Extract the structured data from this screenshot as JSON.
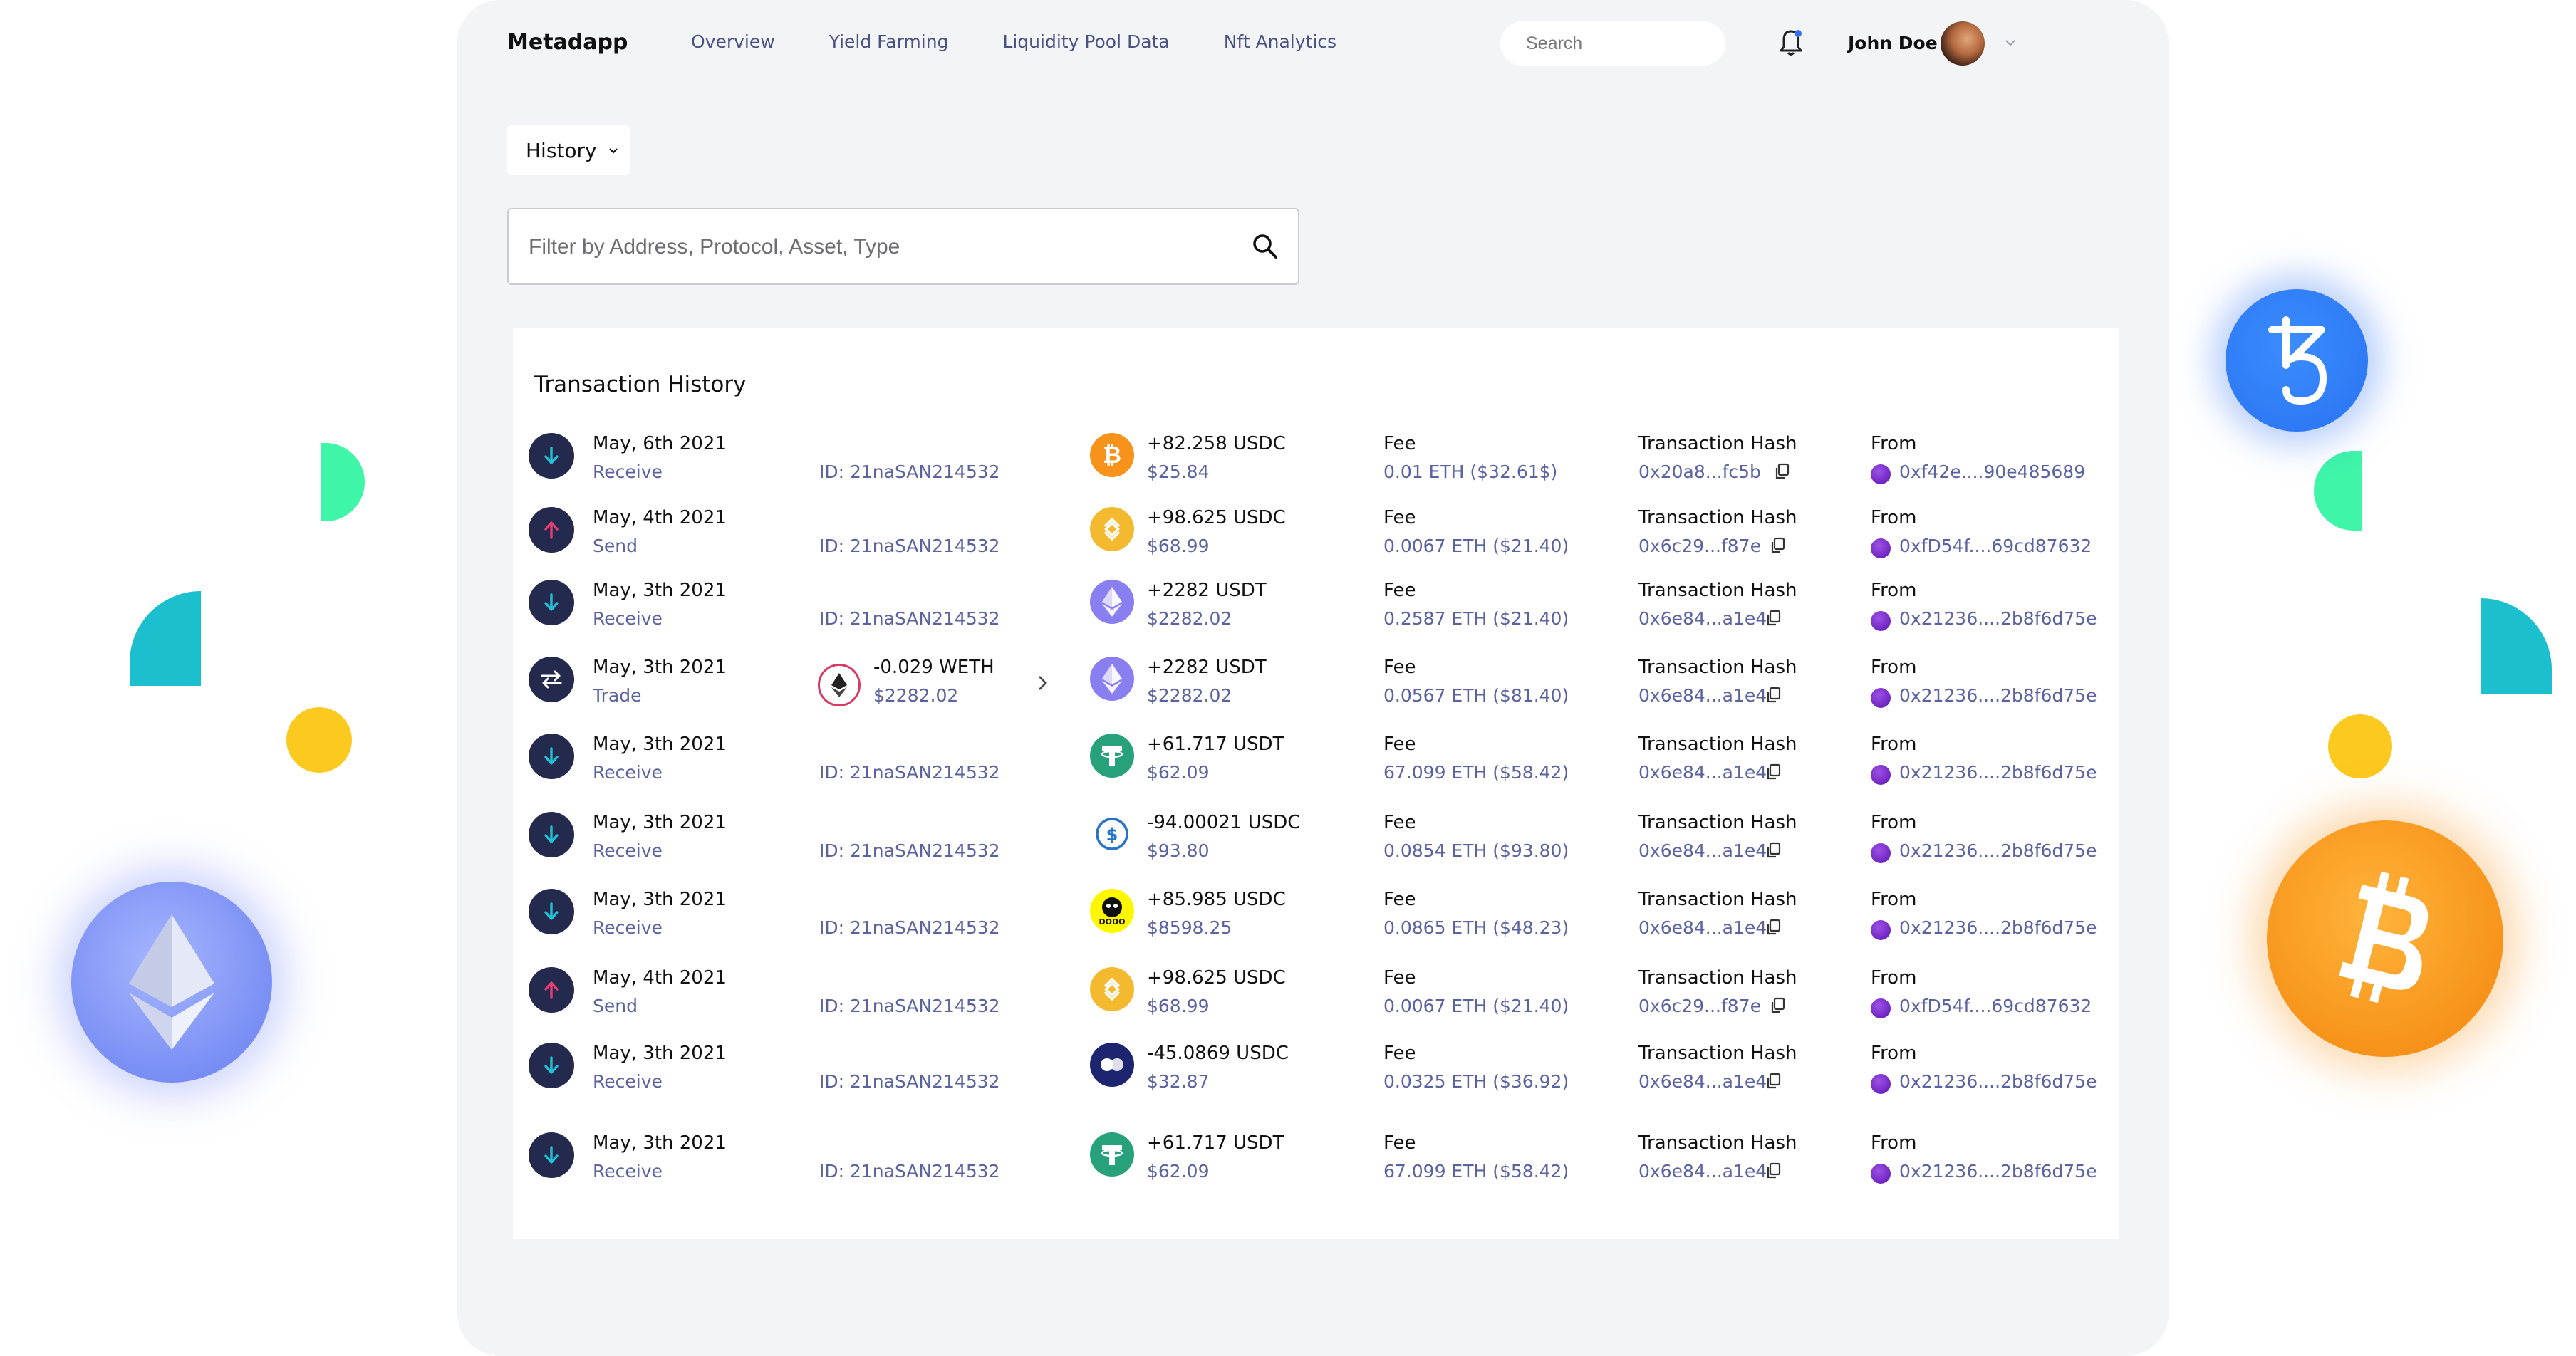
{
  "app": {
    "brand": "Metadapp",
    "nav": [
      "Overview",
      "Yield Farming",
      "Liquidity Pool Data",
      "Nft Analytics"
    ],
    "search_placeholder": "Search",
    "user_name": "John Doe"
  },
  "history_dropdown": "History",
  "filter_placeholder": "Filter by Address, Protocol, Asset, Type",
  "card_title": "Transaction History",
  "labels": {
    "fee": "Fee",
    "hash": "Transaction Hash",
    "from": "From"
  },
  "transactions": [
    {
      "direction": "receive",
      "date": "May, 6th 2021",
      "type": "Receive",
      "id": "ID: 21naSAN214532",
      "asset_icon": "bitcoin-icon",
      "asset_color": "#f7931a",
      "amount": "+82.258 USDC",
      "usd": "$25.84",
      "fee": "0.01 ETH ($32.61$)",
      "hash": "0x20a8...fc5b",
      "from": "0xf42e....90e485689"
    },
    {
      "direction": "send",
      "date": "May, 4th 2021",
      "type": "Send",
      "id": "ID: 21naSAN214532",
      "asset_icon": "binance-icon",
      "asset_color": "#f3ba2f",
      "amount": "+98.625 USDC",
      "usd": "$68.99",
      "fee": "0.0067 ETH ($21.40)",
      "hash": "0x6c29...f87e",
      "from": "0xfD54f....69cd87632"
    },
    {
      "direction": "receive",
      "date": "May, 3th 2021",
      "type": "Receive",
      "id": "ID: 21naSAN214532",
      "asset_icon": "ethereum-icon",
      "asset_color": "#8a7ff0",
      "amount": "+2282 USDT",
      "usd": "$2282.02",
      "fee": "0.2587 ETH ($21.40)",
      "hash": "0x6e84...a1e4",
      "from": "0x21236....2b8f6d75e"
    },
    {
      "direction": "trade",
      "date": "May, 3th 2021",
      "type": "Trade",
      "trade_amount": "-0.029 WETH",
      "trade_usd": "$2282.02",
      "asset_icon": "ethereum-icon",
      "asset_color": "#8a7ff0",
      "amount": "+2282 USDT",
      "usd": "$2282.02",
      "fee": "0.0567 ETH ($81.40)",
      "hash": "0x6e84...a1e4",
      "from": "0x21236....2b8f6d75e"
    },
    {
      "direction": "receive",
      "date": "May, 3th 2021",
      "type": "Receive",
      "id": "ID: 21naSAN214532",
      "asset_icon": "tether-icon",
      "asset_color": "#26a17b",
      "amount": "+61.717 USDT",
      "usd": "$62.09",
      "fee": "67.099 ETH ($58.42)",
      "hash": "0x6e84...a1e4",
      "from": "0x21236....2b8f6d75e"
    },
    {
      "direction": "receive",
      "date": "May, 3th 2021",
      "type": "Receive",
      "id": "ID: 21naSAN214532",
      "asset_icon": "usdc-icon",
      "asset_color": "#2775ca",
      "amount": "-94.00021 USDC",
      "usd": "$93.80",
      "fee": "0.0854 ETH ($93.80)",
      "hash": "0x6e84...a1e4",
      "from": "0x21236....2b8f6d75e"
    },
    {
      "direction": "receive",
      "date": "May, 3th 2021",
      "type": "Receive",
      "id": "ID: 21naSAN214532",
      "asset_icon": "dodo-icon",
      "asset_color": "#fff700",
      "amount": "+85.985 USDC",
      "usd": "$8598.25",
      "fee": "0.0865 ETH ($48.23)",
      "hash": "0x6e84...a1e4",
      "from": "0x21236....2b8f6d75e"
    },
    {
      "direction": "send",
      "date": "May, 4th 2021",
      "type": "Send",
      "id": "ID: 21naSAN214532",
      "asset_icon": "binance-icon",
      "asset_color": "#f3ba2f",
      "amount": "+98.625 USDC",
      "usd": "$68.99",
      "fee": "0.0067 ETH ($21.40)",
      "hash": "0x6c29...f87e",
      "from": "0xfD54f....69cd87632"
    },
    {
      "direction": "receive",
      "date": "May, 3th 2021",
      "type": "Receive",
      "id": "ID: 21naSAN214532",
      "asset_icon": "celsius-icon",
      "asset_color": "#1d2470",
      "amount": "-45.0869 USDC",
      "usd": "$32.87",
      "fee": "0.0325 ETH ($36.92)",
      "hash": "0x6e84...a1e4",
      "from": "0x21236....2b8f6d75e"
    },
    {
      "direction": "receive",
      "date": "May, 3th 2021",
      "type": "Receive",
      "id": "ID: 21naSAN214532",
      "asset_icon": "tether-icon",
      "asset_color": "#26a17b",
      "amount": "+61.717 USDT",
      "usd": "$62.09",
      "fee": "67.099 ETH ($58.42)",
      "hash": "0x6e84...a1e4",
      "from": "0x21236....2b8f6d75e"
    }
  ]
}
